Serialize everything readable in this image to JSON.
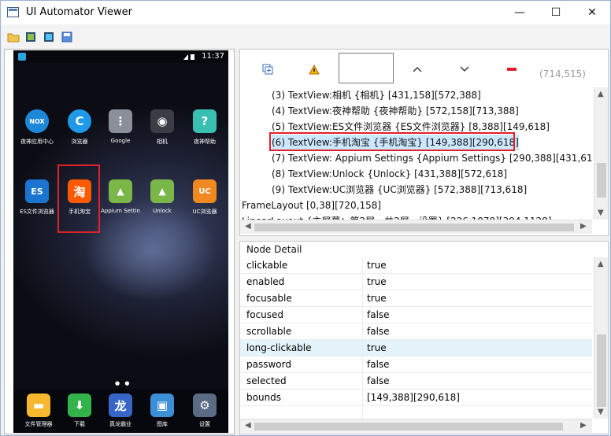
{
  "window": {
    "title": "UI Automator Viewer",
    "minimize": "—",
    "maximize": "☐",
    "close": "✕"
  },
  "toolbar_icons": [
    "open-icon",
    "screenshot-icon",
    "compressed-screenshot-icon",
    "save-icon"
  ],
  "device": {
    "status_time": "11:37",
    "apps_row1": [
      {
        "label": "夜神应用中心",
        "icon": "nox-app-center-icon",
        "color": "#1e88d8",
        "glyph": "NOX"
      },
      {
        "label": "浏览器",
        "icon": "browser-icon",
        "color": "#1e9ae8",
        "glyph": "C"
      },
      {
        "label": "Google",
        "icon": "google-folder-icon",
        "color": "#8a8f99",
        "glyph": "⋮"
      },
      {
        "label": "相机",
        "icon": "camera-icon",
        "color": "#3a3d45",
        "glyph": "◉"
      },
      {
        "label": "夜神帮助",
        "icon": "nox-help-icon",
        "color": "#3ac0b0",
        "glyph": "?"
      }
    ],
    "apps_row2": [
      {
        "label": "ES文件浏览器",
        "icon": "es-file-explorer-icon",
        "color": "#1a74d0",
        "glyph": "ES"
      },
      {
        "label": "手机淘宝",
        "icon": "taobao-icon",
        "color": "#ff5a00",
        "glyph": "淘"
      },
      {
        "label": "Appium Settin",
        "icon": "appium-settings-icon",
        "color": "#7ab648",
        "glyph": "▲"
      },
      {
        "label": "Unlock",
        "icon": "unlock-icon",
        "color": "#7ab648",
        "glyph": "▲"
      },
      {
        "label": "UC浏览器",
        "icon": "uc-browser-icon",
        "color": "#f08a20",
        "glyph": "UC"
      }
    ],
    "dock": [
      {
        "label": "文件管理器",
        "icon": "file-manager-icon",
        "color": "#f5b82e",
        "glyph": "▬"
      },
      {
        "label": "下载",
        "icon": "download-icon",
        "color": "#33b44a",
        "glyph": "⬇"
      },
      {
        "label": "真龙霸业",
        "icon": "game-icon",
        "color": "#3866c8",
        "glyph": "龙"
      },
      {
        "label": "图库",
        "icon": "gallery-icon",
        "color": "#3a8fd6",
        "glyph": "▣"
      },
      {
        "label": "设置",
        "icon": "settings-icon",
        "color": "#5b6b85",
        "glyph": "⚙"
      }
    ]
  },
  "hierarchy_toolbar": {
    "buttons": [
      "expand-all-icon",
      "warning-icon",
      "",
      "up-icon",
      "down-icon",
      "minus-icon"
    ],
    "coords": "(714,515)"
  },
  "tree": [
    {
      "text": "(3) TextView:相机 {相机} [431,158][572,388]",
      "indent": true
    },
    {
      "text": "(4) TextView:夜神帮助 {夜神帮助} [572,158][713,388]",
      "indent": true
    },
    {
      "text": "(5) TextView:ES文件浏览器 {ES文件浏览器} [8,388][149,618]",
      "indent": true
    },
    {
      "text": "(6) TextView:手机淘宝 {手机淘宝} [149,388][290,618]",
      "indent": true,
      "selected": true
    },
    {
      "text": "(7) TextView:     Appium Settings {Appium Settings} [290,388][431,618]",
      "indent": true
    },
    {
      "text": "(8) TextView:Unlock {Unlock} [431,388][572,618]",
      "indent": true
    },
    {
      "text": "(9) TextView:UC浏览器 {UC浏览器} [572,388][713,618]",
      "indent": true
    },
    {
      "text": "FrameLayout [0,38][720,158]",
      "indent": false
    },
    {
      "text": "LinearLayout {主屏幕：第2屏，共2屏，设置} [226,1078][394,1128]",
      "indent": false
    }
  ],
  "node_detail": {
    "title": "Node Detail",
    "rows": [
      {
        "key": "clickable",
        "value": "true"
      },
      {
        "key": "enabled",
        "value": "true"
      },
      {
        "key": "focusable",
        "value": "true"
      },
      {
        "key": "focused",
        "value": "false"
      },
      {
        "key": "scrollable",
        "value": "false"
      },
      {
        "key": "long-clickable",
        "value": "true",
        "selected": true
      },
      {
        "key": "password",
        "value": "false"
      },
      {
        "key": "selected",
        "value": "false"
      },
      {
        "key": "bounds",
        "value": "[149,388][290,618]"
      }
    ]
  }
}
